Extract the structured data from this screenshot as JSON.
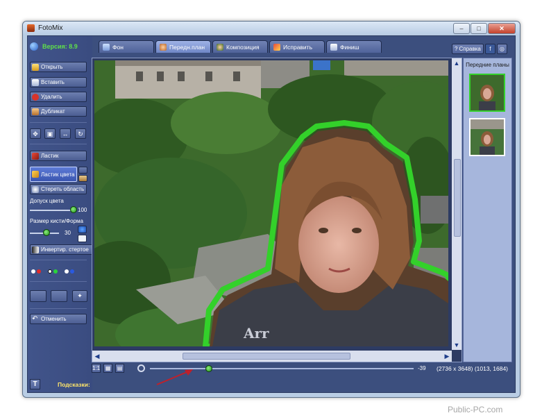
{
  "window": {
    "title": "FotoMix",
    "version": "Версия: 8.9"
  },
  "tabs": [
    {
      "label": "Фон"
    },
    {
      "label": "Передн.план"
    },
    {
      "label": "Композиция"
    },
    {
      "label": "Исправить"
    },
    {
      "label": "Финиш"
    }
  ],
  "active_tab": "Передн.план",
  "help": {
    "label": "Справка"
  },
  "sidebar": {
    "open": "Открыть",
    "insert": "Вставить",
    "delete": "Удалить",
    "duplicate": "Дубликат",
    "eraser": "Ластик",
    "color_eraser": "Ластик цвета",
    "erase_area": "Стереть область",
    "tolerance_label": "Допуск цвета",
    "tolerance_value": "100",
    "tolerance_level": 1.0,
    "brush_label": "Размер кисти/Форма",
    "brush_value": "30",
    "brush_level": 0.55,
    "invert": "Инвертир. стертое",
    "undo": "Отменить"
  },
  "right_panel": {
    "title": "Передние планы"
  },
  "status": {
    "zoom_value": "-39",
    "zoom_level": 0.22,
    "dimensions": "(2736 x 3648) (1013, 1684)"
  },
  "hint_label": "Подсказки:",
  "watermark": "Public-PC.com",
  "colors": {
    "panel_bg": "#3c4f7e",
    "mask_outline": "#33d12a",
    "version_text": "#5fe04a",
    "hint_text": "#ffe66a",
    "annotation_arrow": "#c0202a"
  }
}
